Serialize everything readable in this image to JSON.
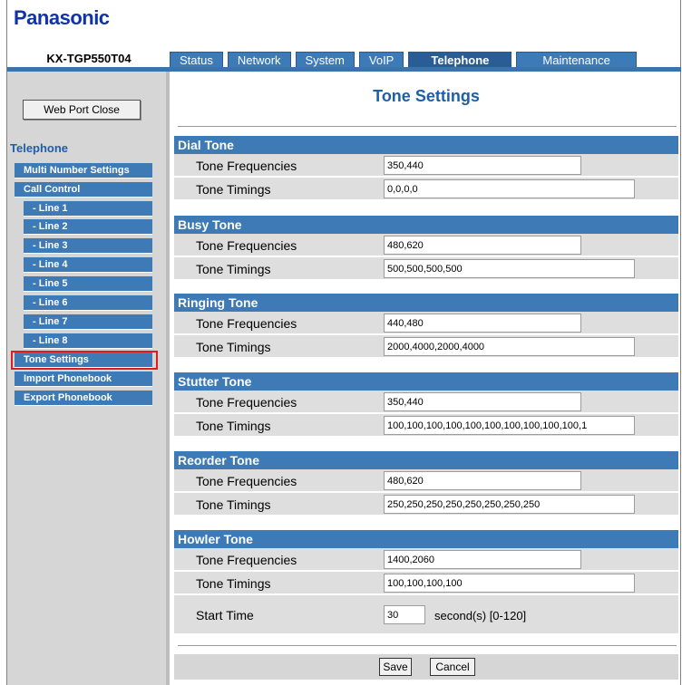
{
  "brand": "Panasonic",
  "model": "KX-TGP550T04",
  "tabs": [
    "Status",
    "Network",
    "System",
    "VoIP",
    "Telephone",
    "Maintenance"
  ],
  "sidebar": {
    "web_port_close": "Web Port Close",
    "section_title": "Telephone",
    "items": [
      "Multi Number Settings",
      "Call Control",
      "- Line 1",
      "- Line 2",
      "- Line 3",
      "- Line 4",
      "- Line 5",
      "- Line 6",
      "- Line 7",
      "- Line 8",
      "Tone Settings",
      "Import Phonebook",
      "Export Phonebook"
    ]
  },
  "page_title": "Tone Settings",
  "sections": [
    {
      "title": "Dial Tone",
      "freq": "350,440",
      "timing": "0,0,0,0"
    },
    {
      "title": "Busy Tone",
      "freq": "480,620",
      "timing": "500,500,500,500"
    },
    {
      "title": "Ringing Tone",
      "freq": "440,480",
      "timing": "2000,4000,2000,4000"
    },
    {
      "title": "Stutter Tone",
      "freq": "350,440",
      "timing": "100,100,100,100,100,100,100,100,100,100,1"
    },
    {
      "title": "Reorder Tone",
      "freq": "480,620",
      "timing": "250,250,250,250,250,250,250,250"
    },
    {
      "title": "Howler Tone",
      "freq": "1400,2060",
      "timing": "100,100,100,100"
    }
  ],
  "labels": {
    "freq": "Tone Frequencies",
    "timing": "Tone Timings",
    "start_time": "Start Time",
    "unit": "second(s) [0-120]"
  },
  "start_time_value": "30",
  "buttons": {
    "save": "Save",
    "cancel": "Cancel"
  }
}
